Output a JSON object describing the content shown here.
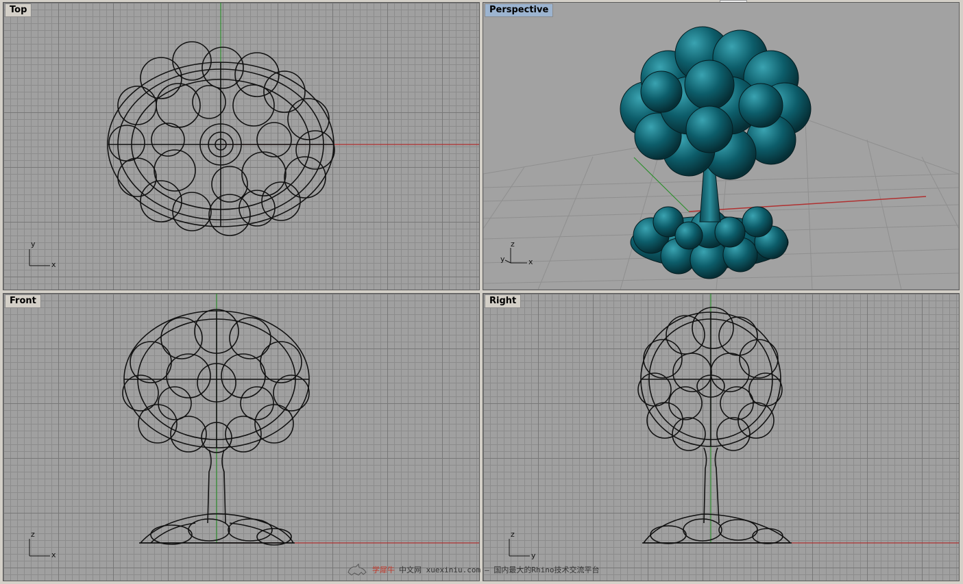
{
  "viewports": {
    "top": {
      "label": "Top",
      "axes": {
        "vertical": "y",
        "horizontal": "x"
      }
    },
    "perspective": {
      "label": "Perspective",
      "axes": {
        "vertical": "z",
        "side": "y",
        "horizontal": "x"
      }
    },
    "front": {
      "label": "Front",
      "axes": {
        "vertical": "z",
        "horizontal": "x"
      }
    },
    "right": {
      "label": "Right",
      "axes": {
        "vertical": "z",
        "horizontal": "y"
      }
    }
  },
  "watermark": {
    "brand": "学犀牛",
    "site": "中文网 xuexiniu.com",
    "tagline": "— 国内最大的Rhino技术交流平台",
    "icon": "rhino-logo-icon"
  },
  "colors": {
    "x_axis": "#b03030",
    "y_axis": "#2f8f2f",
    "model_fill": "#0d5d6a",
    "model_highlight": "#2a8d9b",
    "wire": "#111111",
    "active_label": "#9cb4d0"
  }
}
